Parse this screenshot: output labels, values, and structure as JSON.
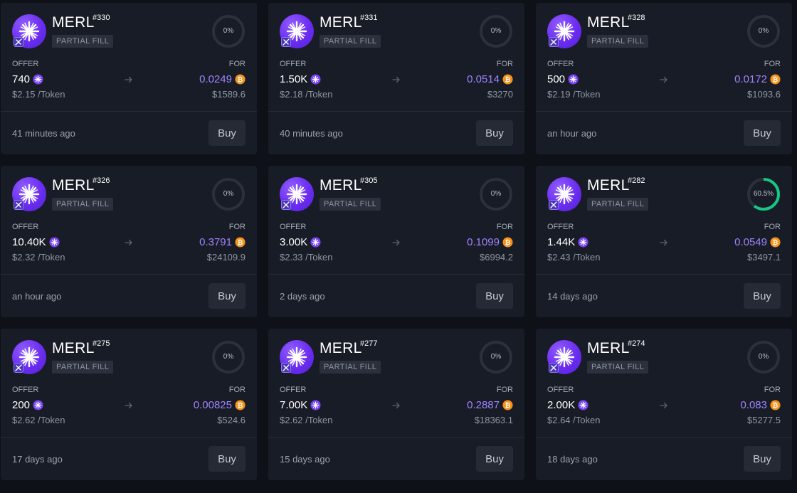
{
  "labels": {
    "offer": "OFFER",
    "for": "FOR",
    "buy": "Buy",
    "partial": "PARTIAL FILL",
    "per_token_suffix": " /Token"
  },
  "colors": {
    "card_bg": "#181c26",
    "page_bg": "#0e1118",
    "accent_purple": "#9d84ff",
    "progress_green": "#16c784",
    "btc_orange": "#f7931a"
  },
  "icons": {
    "token": "merl-star-icon",
    "chain": "merlin-chain-icon",
    "btc": "bitcoin-icon",
    "arrow": "arrow-right-icon"
  },
  "listings": [
    {
      "name": "MERL",
      "number": "#330",
      "status": "PARTIAL FILL",
      "fill_pct": "0%",
      "fill": 0,
      "offer_amount": "740",
      "for_amount": "0.0249",
      "price_per_token": "$2.15",
      "usd_total": "$1589.6",
      "time_ago": "41 minutes ago"
    },
    {
      "name": "MERL",
      "number": "#331",
      "status": "PARTIAL FILL",
      "fill_pct": "0%",
      "fill": 0,
      "offer_amount": "1.50K",
      "for_amount": "0.0514",
      "price_per_token": "$2.18",
      "usd_total": "$3270",
      "time_ago": "40 minutes ago"
    },
    {
      "name": "MERL",
      "number": "#328",
      "status": "PARTIAL FILL",
      "fill_pct": "0%",
      "fill": 0,
      "offer_amount": "500",
      "for_amount": "0.0172",
      "price_per_token": "$2.19",
      "usd_total": "$1093.6",
      "time_ago": "an hour ago"
    },
    {
      "name": "MERL",
      "number": "#326",
      "status": "PARTIAL FILL",
      "fill_pct": "0%",
      "fill": 0,
      "offer_amount": "10.40K",
      "for_amount": "0.3791",
      "price_per_token": "$2.32",
      "usd_total": "$24109.9",
      "time_ago": "an hour ago"
    },
    {
      "name": "MERL",
      "number": "#305",
      "status": "PARTIAL FILL",
      "fill_pct": "0%",
      "fill": 0,
      "offer_amount": "3.00K",
      "for_amount": "0.1099",
      "price_per_token": "$2.33",
      "usd_total": "$6994.2",
      "time_ago": "2 days ago"
    },
    {
      "name": "MERL",
      "number": "#282",
      "status": "PARTIAL FILL",
      "fill_pct": "60.5%",
      "fill": 0.605,
      "offer_amount": "1.44K",
      "for_amount": "0.0549",
      "price_per_token": "$2.43",
      "usd_total": "$3497.1",
      "time_ago": "14 days ago"
    },
    {
      "name": "MERL",
      "number": "#275",
      "status": "PARTIAL FILL",
      "fill_pct": "0%",
      "fill": 0,
      "offer_amount": "200",
      "for_amount": "0.00825",
      "price_per_token": "$2.62",
      "usd_total": "$524.6",
      "time_ago": "17 days ago"
    },
    {
      "name": "MERL",
      "number": "#277",
      "status": "PARTIAL FILL",
      "fill_pct": "0%",
      "fill": 0,
      "offer_amount": "7.00K",
      "for_amount": "0.2887",
      "price_per_token": "$2.62",
      "usd_total": "$18363.1",
      "time_ago": "15 days ago"
    },
    {
      "name": "MERL",
      "number": "#274",
      "status": "PARTIAL FILL",
      "fill_pct": "0%",
      "fill": 0,
      "offer_amount": "2.00K",
      "for_amount": "0.083",
      "price_per_token": "$2.64",
      "usd_total": "$5277.5",
      "time_ago": "18 days ago"
    }
  ]
}
